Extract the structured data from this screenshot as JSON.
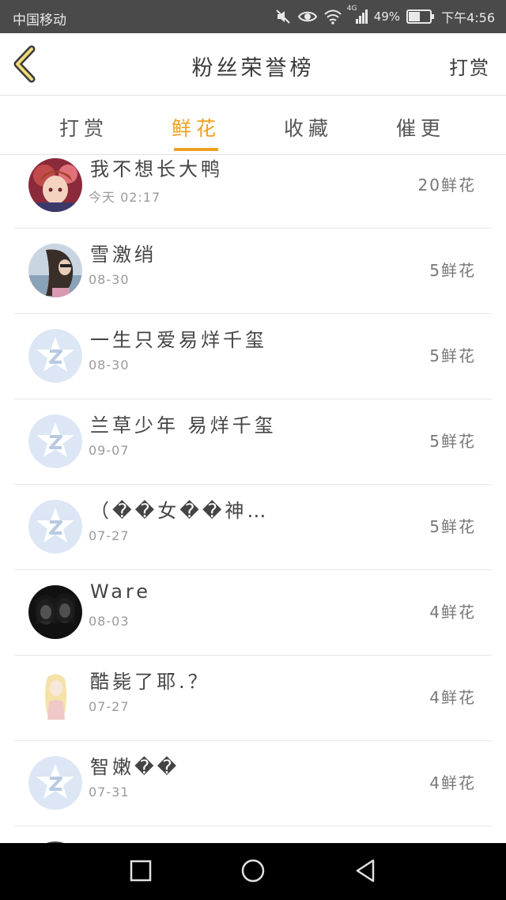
{
  "status_bar": {
    "carrier": "中国移动",
    "network": "4G",
    "battery_pct": "49%",
    "time": "下午4:56"
  },
  "header": {
    "title": "粉丝荣誉榜",
    "action_label": "打赏"
  },
  "tabs": [
    {
      "label": "打赏",
      "active": false
    },
    {
      "label": "鲜花",
      "active": true
    },
    {
      "label": "收藏",
      "active": false
    },
    {
      "label": "催更",
      "active": false
    }
  ],
  "fans": [
    {
      "name": "我不想长大鸭",
      "date": "今天 02:17",
      "amount": "20鲜花",
      "avatar": "anime-avatar"
    },
    {
      "name": "雪激绡",
      "date": "08-30",
      "amount": "5鲜花",
      "avatar": "photo-avatar"
    },
    {
      "name": "一生只爱易烊千玺",
      "date": "08-30",
      "amount": "5鲜花",
      "avatar": "default-avatar"
    },
    {
      "name": "兰草少年 易烊千玺",
      "date": "09-07",
      "amount": "5鲜花",
      "avatar": "default-avatar"
    },
    {
      "name": "（��女��神…",
      "date": "07-27",
      "amount": "5鲜花",
      "avatar": "default-avatar"
    },
    {
      "name": "Ware",
      "date": "08-03",
      "amount": "4鲜花",
      "avatar": "dark-photo-avatar"
    },
    {
      "name": "酷毙了耶.？",
      "date": "07-27",
      "amount": "4鲜花",
      "avatar": "sketch-avatar"
    },
    {
      "name": "智嫩��",
      "date": "07-31",
      "amount": "4鲜花",
      "avatar": "default-avatar"
    }
  ],
  "colors": {
    "accent": "#f0a020",
    "status_bar": "#4a4a4a",
    "divider": "#e6e6e6",
    "default_avatar_bg": "#dce6f4"
  }
}
